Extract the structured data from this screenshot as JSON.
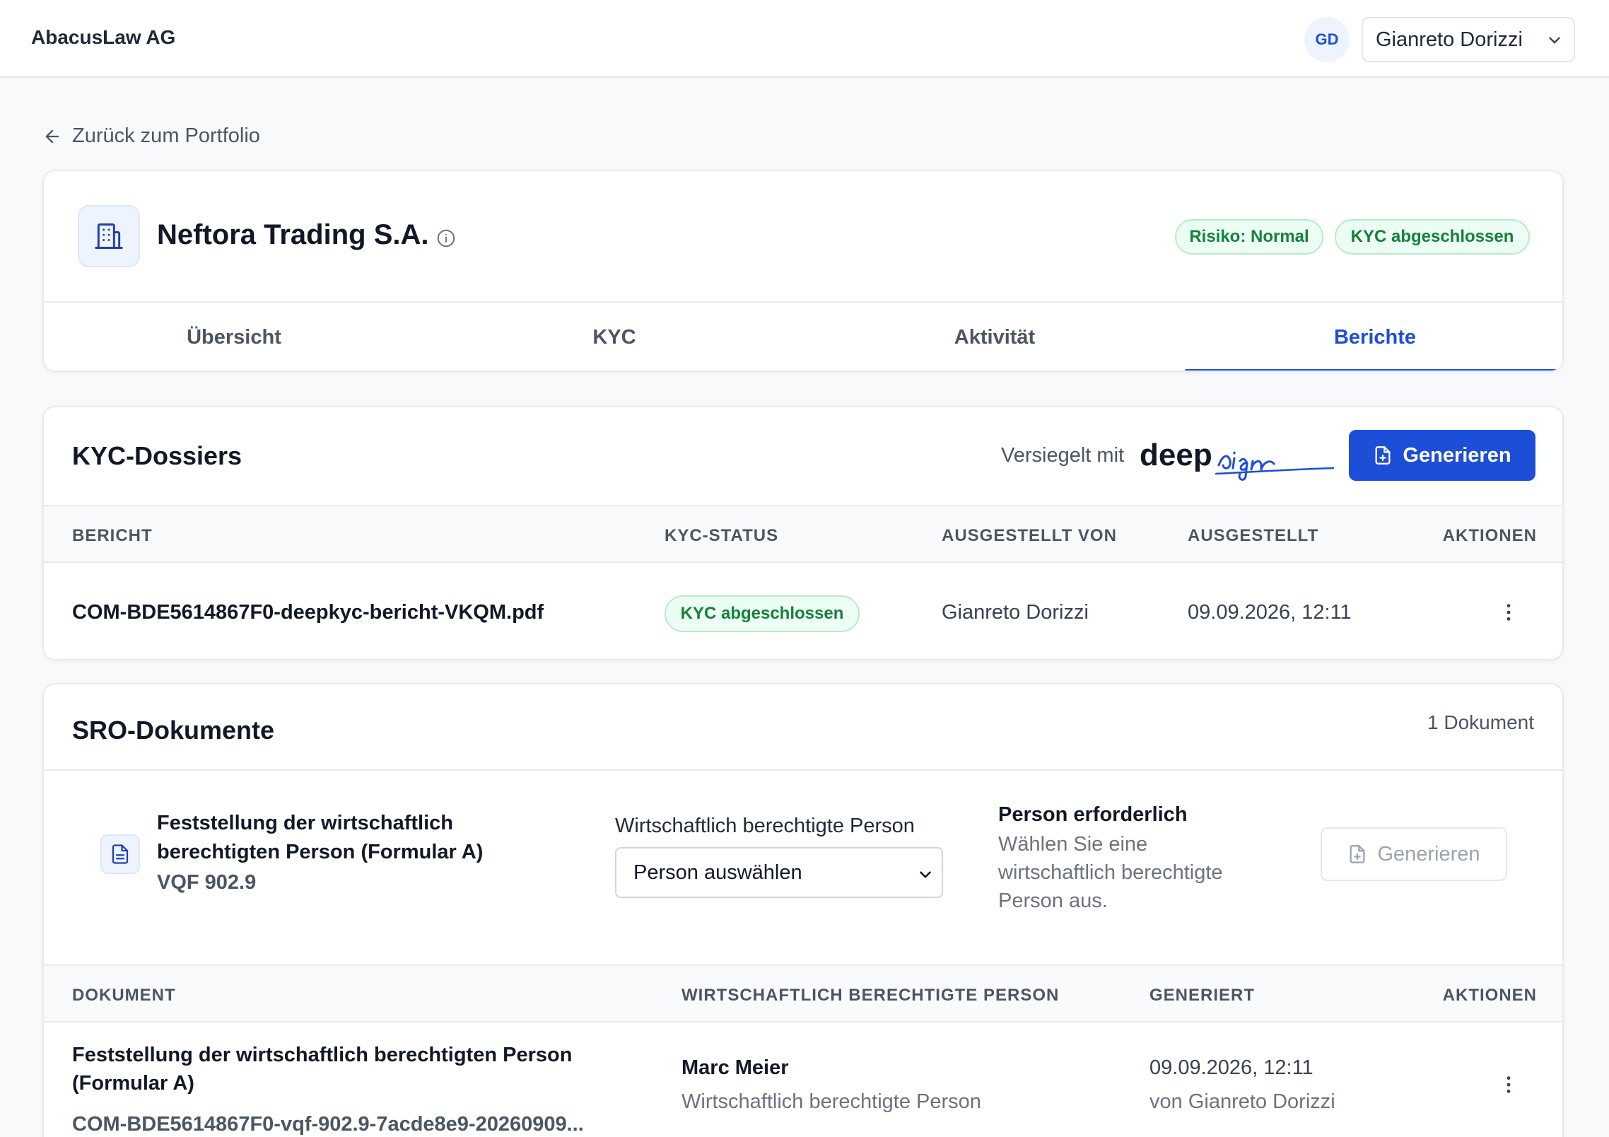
{
  "header": {
    "brand": "AbacusLaw AG",
    "avatar_initials": "GD",
    "user_name": "Gianreto Dorizzi"
  },
  "back_link": "Zurück zum Portfolio",
  "company": {
    "name": "Neftora Trading S.A.",
    "badges": [
      "Risiko: Normal",
      "KYC abgeschlossen"
    ],
    "badge_color": "#15803d"
  },
  "tabs": [
    {
      "label": "Übersicht",
      "active": false
    },
    {
      "label": "KYC",
      "active": false
    },
    {
      "label": "Aktivität",
      "active": false
    },
    {
      "label": "Berichte",
      "active": true
    }
  ],
  "kyc_dossiers": {
    "title": "KYC-Dossiers",
    "sealed_label": "Versiegelt mit",
    "logo_text": "deepsign",
    "generate_label": "Generieren",
    "columns": [
      "BERICHT",
      "KYC-STATUS",
      "AUSGESTELLT VON",
      "AUSGESTELLT",
      "AKTIONEN"
    ],
    "rows": [
      {
        "report": "COM-BDE5614867F0-deepkyc-bericht-VKQM.pdf",
        "status": "KYC abgeschlossen",
        "issued_by": "Gianreto Dorizzi",
        "issued_at": "09.09.2026, 12:11"
      }
    ]
  },
  "sro_documents": {
    "title": "SRO-Dokumente",
    "count": "1 Dokument",
    "form": {
      "title": "Feststellung der wirtschaftlich berechtigten Person (Formular A)",
      "code": "VQF 902.9",
      "select_label": "Wirtschaftlich berechtigte Person",
      "select_value": "Person auswählen",
      "required_title": "Person erforderlich",
      "required_text": "Wählen Sie eine wirtschaftlich berechtigte Person aus.",
      "generate_label": "Generieren"
    },
    "columns": [
      "DOKUMENT",
      "WIRTSCHAFTLICH BERECHTIGTE PERSON",
      "GENERIERT",
      "AKTIONEN"
    ],
    "rows": [
      {
        "doc_title": "Feststellung der wirtschaftlich berechtigten Person (Formular A)",
        "doc_file": "COM-BDE5614867F0-vqf-902.9-7acde8e9-20260909...",
        "person_name": "Marc Meier",
        "person_role": "Wirtschaftlich berechtigte Person",
        "generated_at": "09.09.2026, 12:11",
        "generated_by": "von Gianreto Dorizzi"
      }
    ]
  },
  "colors": {
    "accent": "#1d4ed8",
    "success_bg": "#ecfdf3",
    "success_text": "#15803d"
  }
}
